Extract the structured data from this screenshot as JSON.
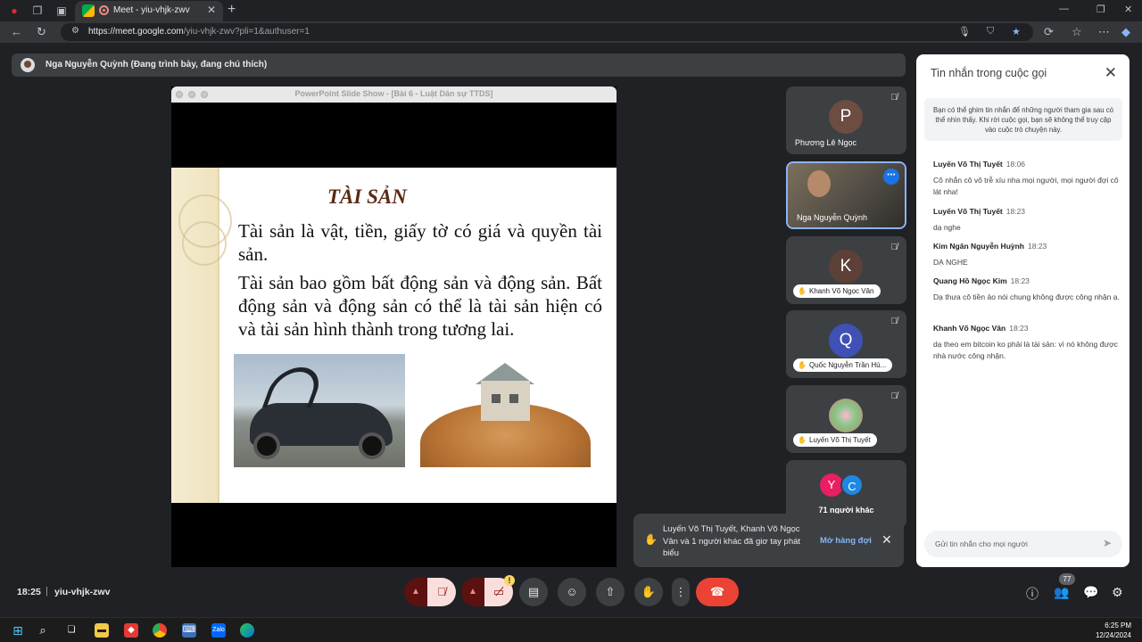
{
  "browser": {
    "tab_title": "Meet - yiu-vhjk-zwv",
    "url_host": "https://meet.google.com",
    "url_path": "/yiu-vhjk-zwv?pli=1&authuser=1"
  },
  "presenter": {
    "text": "Nga Nguyễn Quỳnh (Đang trình bày, đang chú thích)"
  },
  "ppt": {
    "window_title": "PowerPoint Slide Show - [Bài 6 - Luật Dân sự TTDS]",
    "slide_title": "TÀI SẢN",
    "para1": "Tài sản là vật, tiền, giấy tờ có giá và quyền tài sản.",
    "para2": "Tài sản bao gồm bất động sản và động sản. Bất động sản và động sản có thể là tài sản hiện có và tài sản hình thành trong tương lai."
  },
  "participants": [
    {
      "initial": "P",
      "name": "Phương Lê Ngọc",
      "color": "#6d4c41"
    },
    {
      "name": "Nga Nguyễn Quỳnh"
    },
    {
      "initial": "K",
      "name": "Khanh Võ Ngọc Vân",
      "color": "#5d4037"
    },
    {
      "initial": "Q",
      "name": "Quốc Nguyễn Trần Hù...",
      "color": "#3f51b5"
    },
    {
      "name": "Luyến Võ Thị Tuyết"
    },
    {
      "initials": [
        "Y",
        "C"
      ],
      "name": "71 người khác"
    }
  ],
  "toast": {
    "text": "Luyến Võ Thị Tuyết, Khanh Võ Ngọc Vân và 1 người khác đã giơ tay phát biểu",
    "action": "Mở hàng đợi"
  },
  "chat": {
    "title": "Tin nhắn trong cuộc gọi",
    "info": "Bạn có thể ghim tin nhắn để những người tham gia sau có thể nhìn thấy. Khi rời cuộc gọi, bạn sẽ không thể truy cập vào cuộc trò chuyện này.",
    "messages": [
      {
        "sender": "Luyến Võ Thị Tuyết",
        "time": "18:06",
        "text": "Cô nhắn cô vô trễ xíu nha mọi người, mọi người đợi cô lát nha!"
      },
      {
        "sender": "Luyến Võ Thị Tuyết",
        "time": "18:23",
        "text": "dạ nghe"
      },
      {
        "sender": "Kim Ngân Nguyễn Huỳnh",
        "time": "18:23",
        "text": "DẠ NGHE"
      },
      {
        "sender": "Quang Hồ Ngọc Kim",
        "time": "18:23",
        "text": "Dạ thưa cô tiền ảo nói chung không được công nhận ạ."
      },
      {
        "sender": "Khanh Võ Ngọc Vân",
        "time": "18:23",
        "text": "dạ theo em bitcoin ko phải là tài sản: vì nó không được nhà nước công nhận."
      }
    ],
    "input_placeholder": "Gửi tin nhắn cho mọi người"
  },
  "bottom": {
    "clock": "18:25",
    "meeting_code": "yiu-vhjk-zwv",
    "participant_count": "77"
  },
  "taskbar": {
    "time": "6:25 PM",
    "date": "12/24/2024"
  }
}
